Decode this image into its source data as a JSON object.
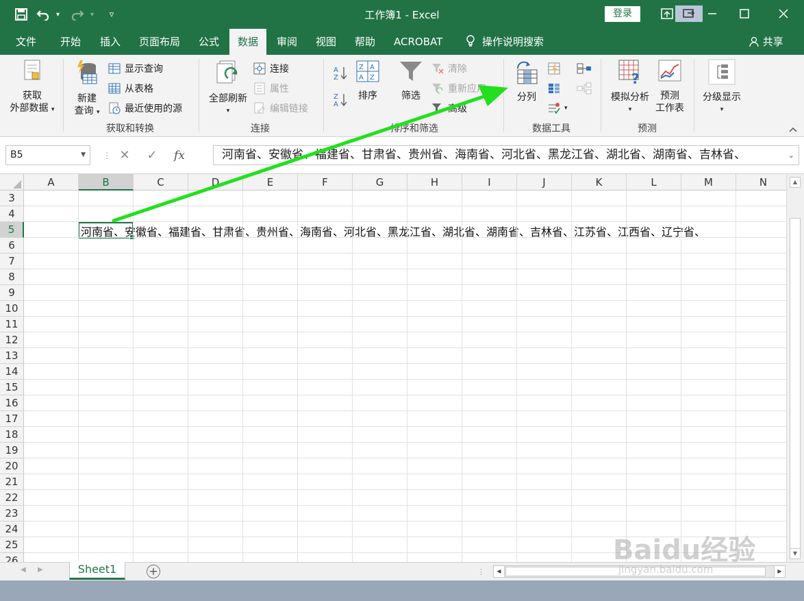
{
  "titlebar": {
    "title": "工作簿1 - Excel",
    "login_label": "登录",
    "share_label": "共享"
  },
  "tabs": [
    {
      "label": "文件"
    },
    {
      "label": "开始"
    },
    {
      "label": "插入"
    },
    {
      "label": "页面布局"
    },
    {
      "label": "公式"
    },
    {
      "label": "数据",
      "active": true
    },
    {
      "label": "审阅"
    },
    {
      "label": "视图"
    },
    {
      "label": "帮助"
    },
    {
      "label": "ACROBAT"
    },
    {
      "label": "操作说明搜索"
    }
  ],
  "ribbon": {
    "get_external_data": {
      "line1": "获取",
      "line2": "外部数据"
    },
    "new_query": {
      "line1": "新建",
      "line2": "查询"
    },
    "show_queries": "显示查询",
    "from_table": "从表格",
    "recent_sources": "最近使用的源",
    "group_get_transform": "获取和转换",
    "refresh_all": "全部刷新",
    "connections": "连接",
    "properties": "属性",
    "edit_links": "编辑链接",
    "group_connections": "连接",
    "sort": "排序",
    "filter": "筛选",
    "clear": "清除",
    "reapply": "重新应用",
    "advanced": "高级",
    "group_sort_filter": "排序和筛选",
    "text_to_columns": "分列",
    "group_data_tools": "数据工具",
    "what_if": "模拟分析",
    "forecast_sheet": {
      "line1": "预测",
      "line2": "工作表"
    },
    "group_forecast": "预测",
    "outline": "分级显示"
  },
  "formula_bar": {
    "name_box": "B5",
    "fx": "fx",
    "content": "河南省、安徽省、福建省、甘肃省、贵州省、海南省、河北省、黑龙江省、湖北省、湖南省、吉林省、"
  },
  "grid": {
    "columns": [
      "A",
      "B",
      "C",
      "D",
      "E",
      "F",
      "G",
      "H",
      "I",
      "J",
      "K",
      "L",
      "M",
      "N"
    ],
    "selected_column": "B",
    "rows": [
      "3",
      "4",
      "5",
      "6",
      "7",
      "8",
      "9",
      "10",
      "11",
      "12",
      "13",
      "14",
      "15",
      "16",
      "17",
      "18",
      "19",
      "20",
      "21",
      "22",
      "23",
      "24",
      "25",
      "26"
    ],
    "selected_row": "5",
    "b5_text": "河南省、安徽省、福建省、甘肃省、贵州省、海南省、河北省、黑龙江省、湖北省、湖南省、吉林省、江苏省、江西省、辽宁省、"
  },
  "sheets": [
    {
      "label": "Sheet1",
      "active": true
    }
  ],
  "watermark": {
    "main": "Baidu经验",
    "sub": "jingyan.baidu.com"
  },
  "annotation": {
    "arrow_color": "#22e01e"
  }
}
